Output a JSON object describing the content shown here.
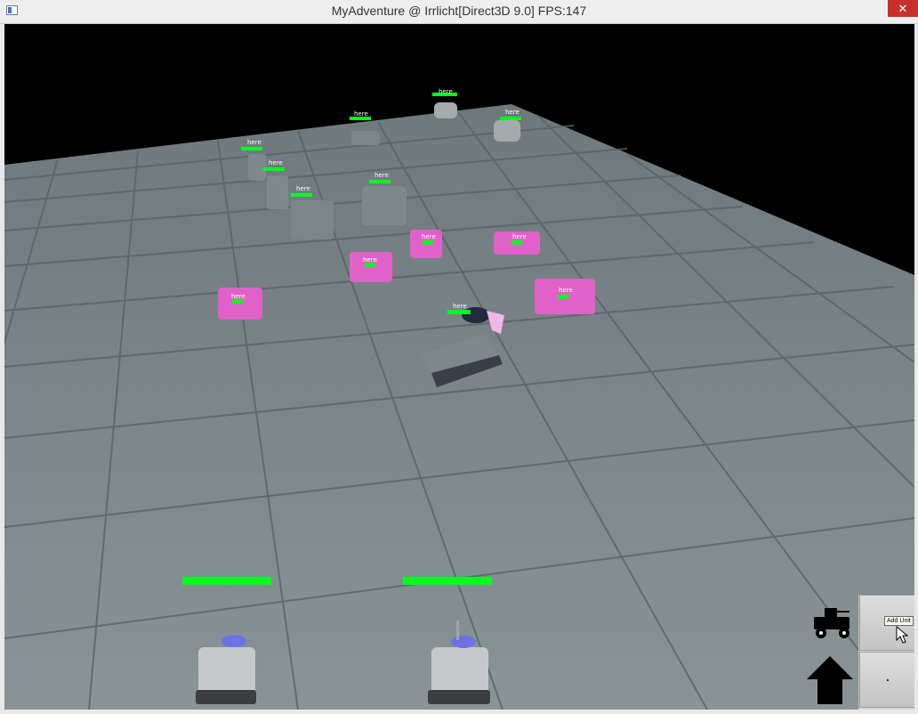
{
  "window": {
    "title": "MyAdventure @ Irrlicht[Direct3D 9.0] FPS:147",
    "close_glyph": "✕"
  },
  "scene": {
    "unit_label": "here",
    "colors": {
      "floor": "#7d878d",
      "grid": "#5e676c",
      "health": "#00ff1e",
      "enemy": "#e062c8",
      "friendly": "#8b9294",
      "sky": "#000000"
    }
  },
  "hud": {
    "add_unit_tooltip": "Add Unit",
    "icons": [
      "tank-icon",
      "up-arrow-icon",
      "cursor-icon"
    ]
  }
}
